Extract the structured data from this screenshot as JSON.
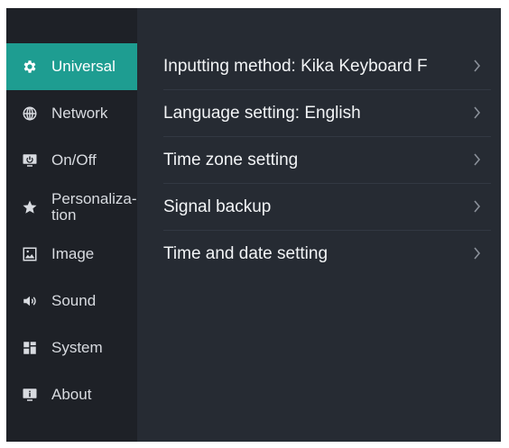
{
  "sidebar": {
    "items": [
      {
        "label": "Universal",
        "icon": "gear-icon",
        "active": true
      },
      {
        "label": "Network",
        "icon": "globe-icon",
        "active": false
      },
      {
        "label": "On/Off",
        "icon": "power-monitor-icon",
        "active": false
      },
      {
        "label": "Personaliza-tion",
        "icon": "star-icon",
        "active": false
      },
      {
        "label": "Image",
        "icon": "image-icon",
        "active": false
      },
      {
        "label": "Sound",
        "icon": "speaker-icon",
        "active": false
      },
      {
        "label": "System",
        "icon": "grid-icon",
        "active": false
      },
      {
        "label": "About",
        "icon": "info-monitor-icon",
        "active": false
      }
    ]
  },
  "main": {
    "rows": [
      {
        "label": "Inputting method:  Kika Keyboard F",
        "icon": "chevron-right-icon"
      },
      {
        "label": "Language setting:  English",
        "icon": "chevron-right-icon"
      },
      {
        "label": "Time zone setting",
        "icon": "chevron-right-icon"
      },
      {
        "label": "Signal backup",
        "icon": "chevron-right-icon"
      },
      {
        "label": "Time and date setting",
        "icon": "chevron-right-icon"
      }
    ]
  },
  "colors": {
    "accent": "#1e9d91",
    "sidebar_bg": "#1e2127",
    "content_bg": "#262b33"
  }
}
